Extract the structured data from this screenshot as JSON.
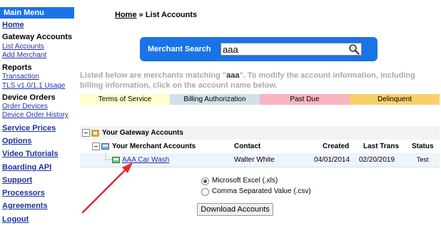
{
  "sidebar": {
    "title": "Main Menu",
    "home": "Home",
    "gateway_header": "Gateway Accounts",
    "list_accounts": "List Accounts",
    "add_merchant": "Add Merchant",
    "reports_header": "Reports",
    "transaction": "Transaction",
    "tls_usage": "TLS v1.0/1.1 Usage",
    "device_header": "Device Orders",
    "order_devices": "Order Devices",
    "device_history": "Device Order History",
    "service_prices": "Service Prices",
    "options": "Options",
    "video_tutorials": "Video Tutorials",
    "boarding_api": "Boarding API",
    "support": "Support",
    "processors": "Processors",
    "agreements": "Agreements",
    "logout": "Logout"
  },
  "breadcrumb": {
    "home": "Home",
    "sep": "»",
    "current": "List Accounts"
  },
  "search": {
    "label": "Merchant Search",
    "value": "aaa"
  },
  "description": {
    "part1": "Listed below are merchants matching \"",
    "query": "aaa",
    "part2": "\". To modify the account information, including billing information, click on the account name below."
  },
  "legend": [
    {
      "label": "Terms of Service",
      "color": "#ffffcc"
    },
    {
      "label": "Billing Authorization",
      "color": "#cfe2ea"
    },
    {
      "label": "Past Due",
      "color": "#f7b5bf"
    },
    {
      "label": "Delinquent",
      "color": "#f8cf6a"
    }
  ],
  "tree": {
    "gateway_accounts": "Your Gateway Accounts",
    "merchant_accounts": "Your Merchant Accounts",
    "headers": {
      "contact": "Contact",
      "created": "Created",
      "last_trans": "Last Trans",
      "status": "Status"
    },
    "rows": [
      {
        "name": "AAA Car Wash",
        "contact": "Walter White",
        "created": "04/01/2014",
        "last_trans": "02/20/2019",
        "status": "Test"
      }
    ]
  },
  "export": {
    "options": [
      "Microsoft Excel (.xls)",
      "Comma Separated Value (.csv)"
    ],
    "selected": "Microsoft Excel (.xls)",
    "button": "Download Accounts"
  },
  "colors": {
    "accent": "#1a73e8",
    "arrow": "#e8262a",
    "link": "#1a3399"
  }
}
